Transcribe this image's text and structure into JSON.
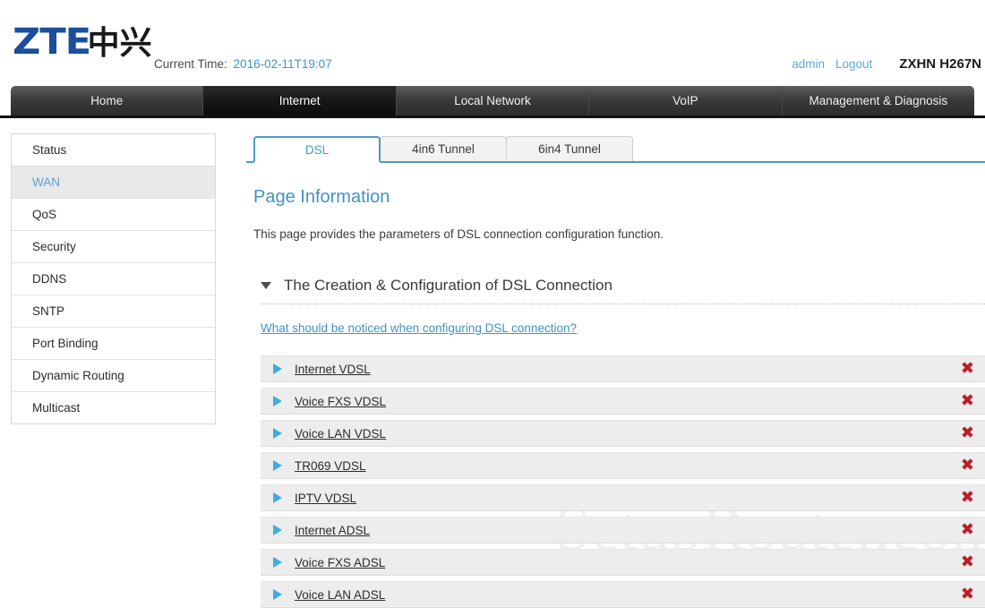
{
  "header": {
    "logo_text": "ZTE",
    "logo_cn": "中兴",
    "time_label": "Current Time:",
    "time_value": "2016-02-11T19:07",
    "user": "admin",
    "logout": "Logout",
    "model": "ZXHN H267N"
  },
  "topnav": {
    "items": [
      {
        "label": "Home",
        "active": false
      },
      {
        "label": "Internet",
        "active": true
      },
      {
        "label": "Local Network",
        "active": false
      },
      {
        "label": "VoIP",
        "active": false
      },
      {
        "label": "Management & Diagnosis",
        "active": false
      }
    ]
  },
  "sidebar": {
    "items": [
      {
        "label": "Status",
        "active": false
      },
      {
        "label": "WAN",
        "active": true
      },
      {
        "label": "QoS",
        "active": false
      },
      {
        "label": "Security",
        "active": false
      },
      {
        "label": "DDNS",
        "active": false
      },
      {
        "label": "SNTP",
        "active": false
      },
      {
        "label": "Port Binding",
        "active": false
      },
      {
        "label": "Dynamic Routing",
        "active": false
      },
      {
        "label": "Multicast",
        "active": false
      }
    ]
  },
  "tabs": [
    {
      "label": "DSL",
      "active": true
    },
    {
      "label": "4in6 Tunnel",
      "active": false
    },
    {
      "label": "6in4 Tunnel",
      "active": false
    }
  ],
  "main": {
    "page_information_title": "Page Information",
    "page_information_desc": "This page provides the parameters of DSL connection configuration function.",
    "section_title": "The Creation & Configuration of DSL Connection",
    "notice_link": "What should be noticed when configuring DSL connection?",
    "connections": [
      {
        "label": "Internet VDSL"
      },
      {
        "label": "Voice FXS VDSL"
      },
      {
        "label": "Voice LAN VDSL"
      },
      {
        "label": "TR069 VDSL"
      },
      {
        "label": "IPTV VDSL"
      },
      {
        "label": "Internet ADSL"
      },
      {
        "label": "Voice FXS ADSL"
      },
      {
        "label": "Voice LAN ADSL"
      }
    ],
    "delete_icon": "✖",
    "expand_icon": "caret-right-icon",
    "collapse_icon": "caret-down-icon"
  },
  "watermark": {
    "text": "SetupRouter.com"
  },
  "colors": {
    "accent_blue": "#3f94c3",
    "tab_border": "#4a9cc0",
    "triangle_blue": "#3aaede",
    "delete_red": "#b91f28",
    "logo_blue": "#1b4f9c",
    "row_bg": "#ededed"
  }
}
